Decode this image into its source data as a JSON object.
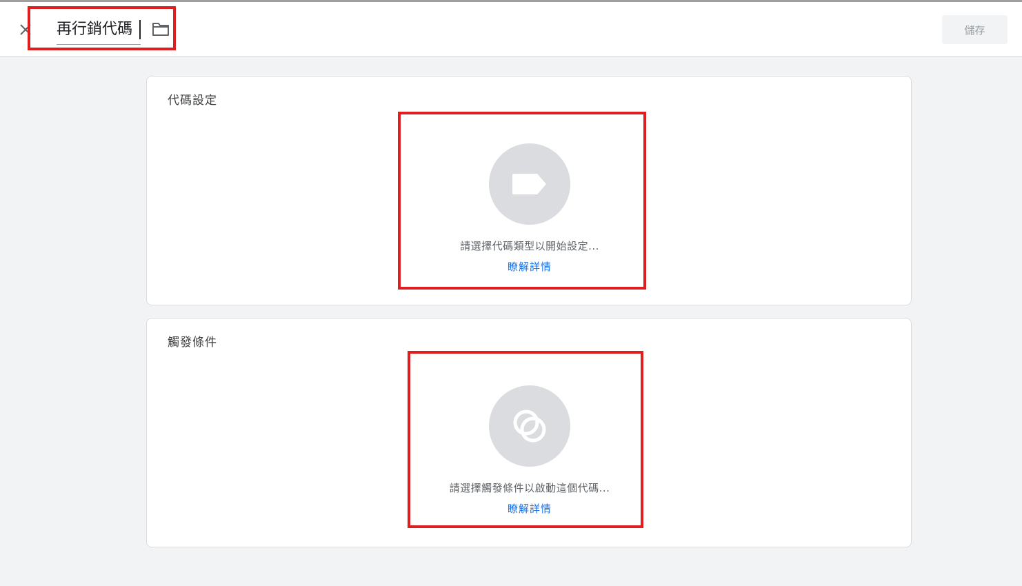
{
  "header": {
    "title_value": "再行銷代碼",
    "save_label": "儲存",
    "close_icon": "close-icon",
    "folder_icon": "folder-icon"
  },
  "tag_config": {
    "title": "代碼設定",
    "icon": "tag-icon",
    "prompt": "請選擇代碼類型以開始設定...",
    "learn_more": "瞭解詳情"
  },
  "triggering": {
    "title": "觸發條件",
    "icon": "trigger-icon",
    "prompt": "請選擇觸發條件以啟動這個代碼...",
    "learn_more": "瞭解詳情"
  },
  "colors": {
    "highlight": "#dd1f1f",
    "link": "#1a73e8",
    "placeholder_circle": "#dadce0"
  }
}
